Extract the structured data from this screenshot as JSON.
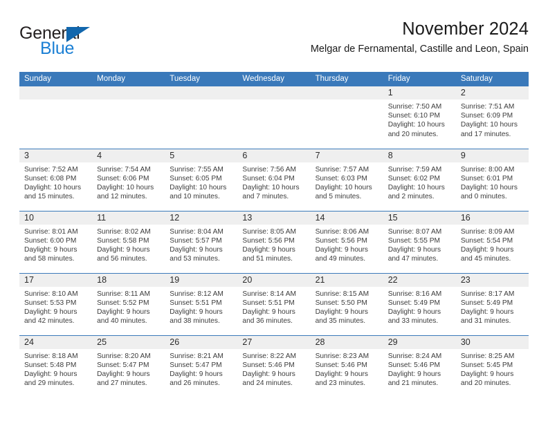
{
  "brand": {
    "word_one": "General",
    "word_two": "Blue",
    "triangle_icon": "triangle-icon",
    "accent_dark_blue": "#1267ad",
    "accent_blue": "#1a7fd4"
  },
  "header": {
    "title": "November 2024",
    "subtitle": "Melgar de Fernamental, Castille and Leon, Spain",
    "header_bg": "#3a79ba",
    "daynum_bg": "#efefef"
  },
  "calendar": {
    "weekday_headers": [
      "Sunday",
      "Monday",
      "Tuesday",
      "Wednesday",
      "Thursday",
      "Friday",
      "Saturday"
    ],
    "labels": {
      "sunrise": "Sunrise:",
      "sunset": "Sunset:",
      "daylight": "Daylight:"
    },
    "weeks": [
      [
        {
          "day": "",
          "empty": true
        },
        {
          "day": "",
          "empty": true
        },
        {
          "day": "",
          "empty": true
        },
        {
          "day": "",
          "empty": true
        },
        {
          "day": "",
          "empty": true
        },
        {
          "day": "1",
          "sunrise": "Sunrise: 7:50 AM",
          "sunset": "Sunset: 6:10 PM",
          "daylight_a": "Daylight: 10 hours",
          "daylight_b": "and 20 minutes."
        },
        {
          "day": "2",
          "sunrise": "Sunrise: 7:51 AM",
          "sunset": "Sunset: 6:09 PM",
          "daylight_a": "Daylight: 10 hours",
          "daylight_b": "and 17 minutes."
        }
      ],
      [
        {
          "day": "3",
          "sunrise": "Sunrise: 7:52 AM",
          "sunset": "Sunset: 6:08 PM",
          "daylight_a": "Daylight: 10 hours",
          "daylight_b": "and 15 minutes."
        },
        {
          "day": "4",
          "sunrise": "Sunrise: 7:54 AM",
          "sunset": "Sunset: 6:06 PM",
          "daylight_a": "Daylight: 10 hours",
          "daylight_b": "and 12 minutes."
        },
        {
          "day": "5",
          "sunrise": "Sunrise: 7:55 AM",
          "sunset": "Sunset: 6:05 PM",
          "daylight_a": "Daylight: 10 hours",
          "daylight_b": "and 10 minutes."
        },
        {
          "day": "6",
          "sunrise": "Sunrise: 7:56 AM",
          "sunset": "Sunset: 6:04 PM",
          "daylight_a": "Daylight: 10 hours",
          "daylight_b": "and 7 minutes."
        },
        {
          "day": "7",
          "sunrise": "Sunrise: 7:57 AM",
          "sunset": "Sunset: 6:03 PM",
          "daylight_a": "Daylight: 10 hours",
          "daylight_b": "and 5 minutes."
        },
        {
          "day": "8",
          "sunrise": "Sunrise: 7:59 AM",
          "sunset": "Sunset: 6:02 PM",
          "daylight_a": "Daylight: 10 hours",
          "daylight_b": "and 2 minutes."
        },
        {
          "day": "9",
          "sunrise": "Sunrise: 8:00 AM",
          "sunset": "Sunset: 6:01 PM",
          "daylight_a": "Daylight: 10 hours",
          "daylight_b": "and 0 minutes."
        }
      ],
      [
        {
          "day": "10",
          "sunrise": "Sunrise: 8:01 AM",
          "sunset": "Sunset: 6:00 PM",
          "daylight_a": "Daylight: 9 hours",
          "daylight_b": "and 58 minutes."
        },
        {
          "day": "11",
          "sunrise": "Sunrise: 8:02 AM",
          "sunset": "Sunset: 5:58 PM",
          "daylight_a": "Daylight: 9 hours",
          "daylight_b": "and 56 minutes."
        },
        {
          "day": "12",
          "sunrise": "Sunrise: 8:04 AM",
          "sunset": "Sunset: 5:57 PM",
          "daylight_a": "Daylight: 9 hours",
          "daylight_b": "and 53 minutes."
        },
        {
          "day": "13",
          "sunrise": "Sunrise: 8:05 AM",
          "sunset": "Sunset: 5:56 PM",
          "daylight_a": "Daylight: 9 hours",
          "daylight_b": "and 51 minutes."
        },
        {
          "day": "14",
          "sunrise": "Sunrise: 8:06 AM",
          "sunset": "Sunset: 5:56 PM",
          "daylight_a": "Daylight: 9 hours",
          "daylight_b": "and 49 minutes."
        },
        {
          "day": "15",
          "sunrise": "Sunrise: 8:07 AM",
          "sunset": "Sunset: 5:55 PM",
          "daylight_a": "Daylight: 9 hours",
          "daylight_b": "and 47 minutes."
        },
        {
          "day": "16",
          "sunrise": "Sunrise: 8:09 AM",
          "sunset": "Sunset: 5:54 PM",
          "daylight_a": "Daylight: 9 hours",
          "daylight_b": "and 45 minutes."
        }
      ],
      [
        {
          "day": "17",
          "sunrise": "Sunrise: 8:10 AM",
          "sunset": "Sunset: 5:53 PM",
          "daylight_a": "Daylight: 9 hours",
          "daylight_b": "and 42 minutes."
        },
        {
          "day": "18",
          "sunrise": "Sunrise: 8:11 AM",
          "sunset": "Sunset: 5:52 PM",
          "daylight_a": "Daylight: 9 hours",
          "daylight_b": "and 40 minutes."
        },
        {
          "day": "19",
          "sunrise": "Sunrise: 8:12 AM",
          "sunset": "Sunset: 5:51 PM",
          "daylight_a": "Daylight: 9 hours",
          "daylight_b": "and 38 minutes."
        },
        {
          "day": "20",
          "sunrise": "Sunrise: 8:14 AM",
          "sunset": "Sunset: 5:51 PM",
          "daylight_a": "Daylight: 9 hours",
          "daylight_b": "and 36 minutes."
        },
        {
          "day": "21",
          "sunrise": "Sunrise: 8:15 AM",
          "sunset": "Sunset: 5:50 PM",
          "daylight_a": "Daylight: 9 hours",
          "daylight_b": "and 35 minutes."
        },
        {
          "day": "22",
          "sunrise": "Sunrise: 8:16 AM",
          "sunset": "Sunset: 5:49 PM",
          "daylight_a": "Daylight: 9 hours",
          "daylight_b": "and 33 minutes."
        },
        {
          "day": "23",
          "sunrise": "Sunrise: 8:17 AM",
          "sunset": "Sunset: 5:49 PM",
          "daylight_a": "Daylight: 9 hours",
          "daylight_b": "and 31 minutes."
        }
      ],
      [
        {
          "day": "24",
          "sunrise": "Sunrise: 8:18 AM",
          "sunset": "Sunset: 5:48 PM",
          "daylight_a": "Daylight: 9 hours",
          "daylight_b": "and 29 minutes."
        },
        {
          "day": "25",
          "sunrise": "Sunrise: 8:20 AM",
          "sunset": "Sunset: 5:47 PM",
          "daylight_a": "Daylight: 9 hours",
          "daylight_b": "and 27 minutes."
        },
        {
          "day": "26",
          "sunrise": "Sunrise: 8:21 AM",
          "sunset": "Sunset: 5:47 PM",
          "daylight_a": "Daylight: 9 hours",
          "daylight_b": "and 26 minutes."
        },
        {
          "day": "27",
          "sunrise": "Sunrise: 8:22 AM",
          "sunset": "Sunset: 5:46 PM",
          "daylight_a": "Daylight: 9 hours",
          "daylight_b": "and 24 minutes."
        },
        {
          "day": "28",
          "sunrise": "Sunrise: 8:23 AM",
          "sunset": "Sunset: 5:46 PM",
          "daylight_a": "Daylight: 9 hours",
          "daylight_b": "and 23 minutes."
        },
        {
          "day": "29",
          "sunrise": "Sunrise: 8:24 AM",
          "sunset": "Sunset: 5:46 PM",
          "daylight_a": "Daylight: 9 hours",
          "daylight_b": "and 21 minutes."
        },
        {
          "day": "30",
          "sunrise": "Sunrise: 8:25 AM",
          "sunset": "Sunset: 5:45 PM",
          "daylight_a": "Daylight: 9 hours",
          "daylight_b": "and 20 minutes."
        }
      ]
    ]
  }
}
